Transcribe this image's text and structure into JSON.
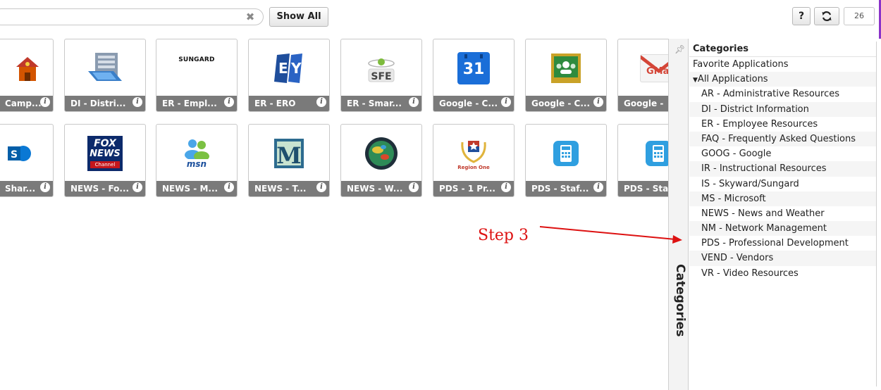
{
  "toolbar": {
    "show_all_label": "Show All",
    "help_label": "?",
    "count": "26"
  },
  "tiles_row1": [
    {
      "label": "Camp..."
    },
    {
      "label": "DI - Distri..."
    },
    {
      "label": "ER - Empl..."
    },
    {
      "label": "ER - ERO"
    },
    {
      "label": "ER - Smar..."
    },
    {
      "label": "Google - C..."
    },
    {
      "label": "Google - C..."
    },
    {
      "label": "Google -"
    }
  ],
  "tiles_row2": [
    {
      "label": "Shar..."
    },
    {
      "label": "NEWS - Fo..."
    },
    {
      "label": "NEWS - M..."
    },
    {
      "label": "NEWS - T..."
    },
    {
      "label": "NEWS - W..."
    },
    {
      "label": "PDS - 1 Pr..."
    },
    {
      "label": "PDS - Staf..."
    },
    {
      "label": "PDS - Sta"
    }
  ],
  "icon_text": {
    "sungard": "SUNGARD",
    "sfe": "SFE",
    "calendar_day": "31",
    "gmail": "GMai",
    "fox": "FOX",
    "news": "NEWS",
    "channel": "Channel",
    "msn": "msn",
    "region": "Region One"
  },
  "annotation": {
    "step_label": "Step 3",
    "color": "#dd1111"
  },
  "categories": {
    "side_title": "Categories",
    "header": "Categories",
    "favorite": "Favorite Applications",
    "all": "All Applications",
    "items": [
      "AR - Administrative Resources",
      "DI - District Information",
      "ER - Employee Resources",
      "FAQ - Frequently Asked Questions",
      "GOOG - Google",
      "IR - Instructional Resources",
      "IS - Skyward/Sungard",
      "MS - Microsoft",
      "NEWS - News and Weather",
      "NM - Network Management",
      "PDS - Professional Development",
      "VEND - Vendors",
      "VR - Video Resources"
    ]
  }
}
